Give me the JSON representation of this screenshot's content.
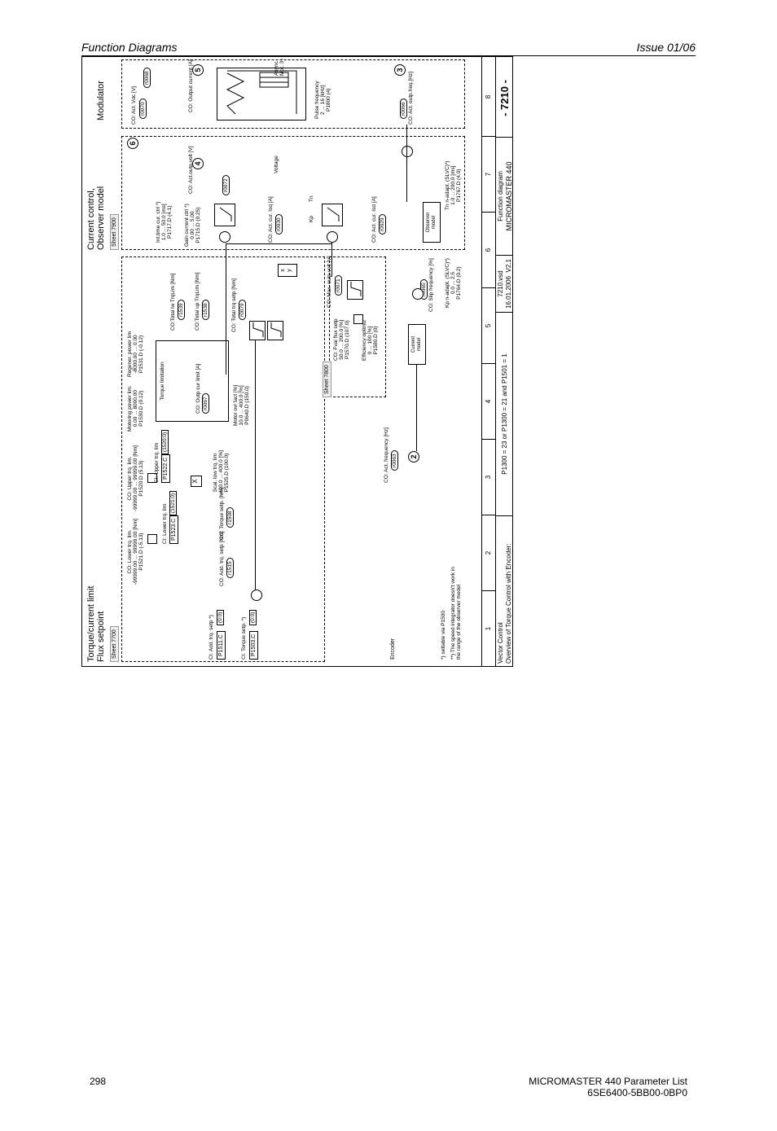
{
  "header": {
    "left": "Function Diagrams",
    "right": "Issue 01/06"
  },
  "footer": {
    "pagenum": "298",
    "product": "MICROMASTER 440   Parameter List",
    "partnum": "6SE6400-5BB00-0BP0"
  },
  "title1": "Torque/current limit",
  "title2": "Flux setpoint",
  "sheet_main": "Sheet 7700",
  "sheet_flux": "Sheet 7800",
  "sect_current": "Current control,",
  "sect_observer": "Observer model",
  "sheet_curr": "Sheet 7900",
  "sect_mod": "Modulator",
  "circle2": "2",
  "circle3": "3",
  "circle4": "4",
  "circle5": "5",
  "circle6": "6",
  "inputs": {
    "add_trq_setp": "CI: Add. trq. setp  *)",
    "add_trq_param": "P1511.C",
    "add_trq_val": "(0:0)",
    "torque_setp": "CI: Torque setp.  *)",
    "torque_setp_param": "P1503.C",
    "torque_setp_val": "(0:0)",
    "settable": "*) settable via P1500",
    "speed_note": "**) The speed integrator doesn't work in\nthe range of the observer model",
    "encoder": "Encoder"
  },
  "trq_limits": {
    "lower_lim": "CO: Lower trq. lim.",
    "lower_range": "-99999.00 ... 99999.00 [Nm]",
    "lower_param": "P1521.D (-5.13)",
    "upper_lim": "CO: Upper trq. lim.",
    "upper_range": "-99999.00 ... 99999.00 [Nm]",
    "upper_param": "P1520.D (5.13)",
    "ci_lower": "CI: Lower trq. lim",
    "ci_lower_param": "P1523.C",
    "ci_lower_val": "(1521:0)",
    "ci_upper": "CI: Upper trq. lim",
    "ci_upper_param": "P1522.C",
    "ci_upper_val": "(1520:0)",
    "scal_low": "Scal. low trq. lim",
    "scal_low_range": "-400.0 ... 400.0 [%]",
    "scal_low_param": "P1525.D (100.0)"
  },
  "power_limits": {
    "motoring": "Motoring power lim.",
    "motoring_range": "0.00 ... 8000.00",
    "motoring_param": "P1530.D (0.12)",
    "regen": "Regener. power lim",
    "regen_range": "-8000.00 ... 0.00",
    "regen_param": "P1531.D (-0.12)",
    "torque_limitation": "Torque limitation",
    "motor_ovl": "Motor ovl fact [%]",
    "motor_ovl_range": "10.0 ... 400.0 [%]",
    "motor_ovl_param": "P0640.D (150.0)"
  },
  "outputs": {
    "add_trq_setp": "CO: Add. trq. setp [Nm]",
    "add_trq_badge": "r1515",
    "torque_setp": "CO: Torque setp. [Nm]",
    "torque_setp_badge": "r1508",
    "total_lw": "CO:Total lw TrqLim [Nm]",
    "total_lw_badge": "r1539",
    "total_up": "CO:Total up TrqLim [Nm]",
    "total_up_badge": "r1538",
    "outp_cur": "CO: Outp cur limit [A]",
    "outp_cur_badge": "r0067",
    "total_trq_setp": "CO: Total trq setp [Nm]",
    "total_trq_badge": "r0079",
    "act_outp_volt": "CO: Act.outp.volt [V]",
    "act_outp_volt_badge": "r0072",
    "vdc": "CO: Act. Vdc [V]",
    "vdc_badge": "r0070",
    "outp_current": "CO: Output current [A]",
    "outp_current_badge": "r0068",
    "max_outp_volt": "CO: Max. outp.volt [V]",
    "max_outp_volt_badge": "r0071",
    "act_freq": "CO: Act. frequency [Hz]",
    "act_freq_badge": "r0063",
    "outp_freq": "CO: Act. outp.freq.[Hz]",
    "outp_freq_badge": "r0066",
    "slip_freq": "CO: Slip frequency [%]",
    "slip_freq_badge": "r0065",
    "isq": "CO: Act. cur. Isq [A]",
    "isq_badge": "r0030",
    "isd": "CO: Act. cur. Isd [A]",
    "isd_badge": "r0029"
  },
  "flux": {
    "fval": "CO: Fval flux setp",
    "fval_range": "50.0 ... 200.0 [%]",
    "fval_param": "P1570.D (107.0)",
    "eff": "Efficiency optimiz",
    "eff_range": "0 ... 100 [%]",
    "eff_param": "P1580.D (0)"
  },
  "control": {
    "int_time": "Int.time cur. ctrl  *)",
    "int_time_range": "1.0 ... 50.0 [ms]",
    "int_time_param": "P1717.D (4.1)",
    "gain": "Gain current ctrl *)",
    "gain_range": "0.00 ... 5.00",
    "gain_param": "P1715.D (0.25)",
    "voltage": "Voltage",
    "kp": "Kp",
    "tn": "Tn",
    "pulse": "Pulse frequency",
    "pulse_range": "2 ... 16 [kHz]",
    "pulse_param": "P1800 (4)",
    "async": "Async\nMot. 3~"
  },
  "models": {
    "current": "Current\nmodel",
    "observer": "Observer\nmodel",
    "kp_adapt": "Kp n-adapt. (SLVC)*)",
    "kp_range": "0.0 ... 2.5",
    "kp_param": "P1764.D (0.2)",
    "tn_adapt": "Tn n-adapt. (SLVC)*)",
    "tn_range": "1.0 ... 200.0 [ms]",
    "tn_param": "P1767.D (4.0)"
  },
  "xy": "x\ny",
  "ruler": {
    "c1": "1",
    "c2": "2",
    "c3": "3",
    "c4": "4",
    "c5": "5",
    "c6": "6",
    "c7": "7",
    "c8": "8"
  },
  "foot": {
    "vc": "Vector Control",
    "overview": "Overview of Torque Control with Encoder:",
    "cond": "P1300 = 23 or P1300 = 21 and P1501 = 1",
    "filename": "7210.vsd",
    "date": "16.01.2006",
    "version": "V2.1",
    "fd": "Function diagram",
    "product": "MICROMASTER 440",
    "num": "- 7210 -"
  }
}
